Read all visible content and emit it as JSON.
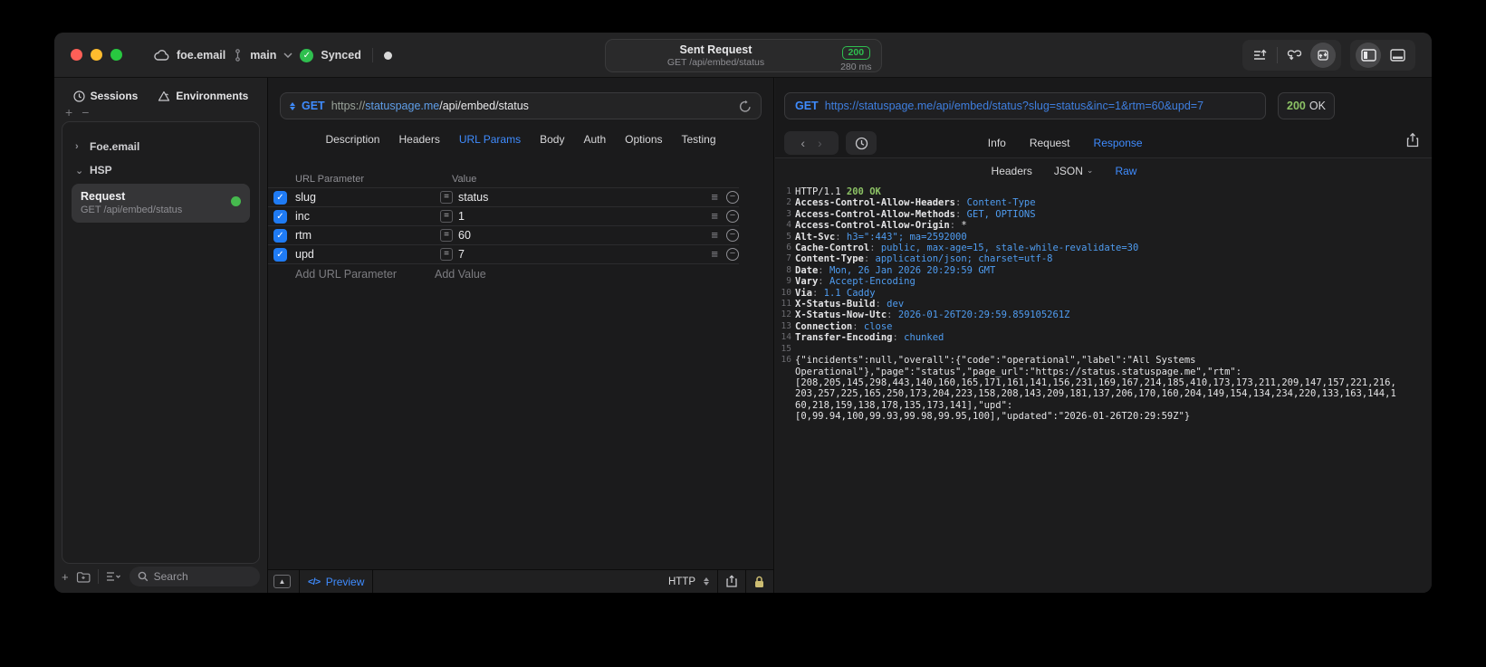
{
  "colors": {
    "accent_blue": "#3f8cff",
    "code_blue": "#4f9cf0",
    "status_green": "#2fbf4f",
    "code_green": "#8cc265",
    "checkbox_blue": "#1f7bf4"
  },
  "titlebar": {
    "project": "foe.email",
    "branch": "main",
    "sync_status": "Synced",
    "center": {
      "title": "Sent Request",
      "subtitle": "GET /api/embed/status",
      "status_code": "200",
      "duration": "280 ms"
    }
  },
  "sidebar": {
    "tabs": [
      {
        "label": "Sessions"
      },
      {
        "label": "Environments"
      }
    ],
    "tree": [
      {
        "label": "Foe.email"
      },
      {
        "label": "HSP"
      }
    ],
    "request_item": {
      "title": "Request",
      "subtitle": "GET /api/embed/status"
    },
    "search_placeholder": "Search"
  },
  "request": {
    "method": "GET",
    "url_scheme": "https://",
    "url_host": "statuspage.me",
    "url_path": "/api/embed/status",
    "tabs": [
      "Description",
      "Headers",
      "URL Params",
      "Body",
      "Auth",
      "Options",
      "Testing"
    ],
    "active_tab": "URL Params",
    "params_table": {
      "columns": [
        "URL Parameter",
        "Value"
      ],
      "rows": [
        {
          "enabled": true,
          "name": "slug",
          "value": "status"
        },
        {
          "enabled": true,
          "name": "inc",
          "value": "1"
        },
        {
          "enabled": true,
          "name": "rtm",
          "value": "60"
        },
        {
          "enabled": true,
          "name": "upd",
          "value": "7"
        }
      ],
      "add_name_placeholder": "Add URL Parameter",
      "add_value_placeholder": "Add Value"
    },
    "footer": {
      "code_glyph": "</>",
      "preview_label": "Preview",
      "protocol": "HTTP"
    }
  },
  "response": {
    "method": "GET",
    "url": "https://statuspage.me/api/embed/status?slug=status&inc=1&rtm=60&upd=7",
    "status_code": "200",
    "status_text": "OK",
    "tabs": [
      "Info",
      "Request",
      "Response"
    ],
    "active_tab": "Response",
    "subtabs": [
      "Headers",
      "JSON",
      "Raw"
    ],
    "active_subtab": "Raw",
    "body_lines": [
      {
        "num": "1",
        "segments": [
          [
            "HTTP/1.1 ",
            "plain"
          ],
          [
            "200 OK",
            "green"
          ]
        ]
      },
      {
        "num": "2",
        "segments": [
          [
            "Access-Control-Allow-Headers",
            "key"
          ],
          [
            ": ",
            "punct"
          ],
          [
            "Content-Type",
            "val"
          ]
        ]
      },
      {
        "num": "3",
        "segments": [
          [
            "Access-Control-Allow-Methods",
            "key"
          ],
          [
            ": ",
            "punct"
          ],
          [
            "GET, OPTIONS",
            "val"
          ]
        ]
      },
      {
        "num": "4",
        "segments": [
          [
            "Access-Control-Allow-Origin",
            "key"
          ],
          [
            ": ",
            "punct"
          ],
          [
            "*",
            "plain"
          ]
        ]
      },
      {
        "num": "5",
        "segments": [
          [
            "Alt-Svc",
            "key"
          ],
          [
            ": ",
            "punct"
          ],
          [
            "h3=\":443\"; ma=2592000",
            "val"
          ]
        ]
      },
      {
        "num": "6",
        "segments": [
          [
            "Cache-Control",
            "key"
          ],
          [
            ": ",
            "punct"
          ],
          [
            "public, max-age=15, stale-while-revalidate=30",
            "val"
          ]
        ]
      },
      {
        "num": "7",
        "segments": [
          [
            "Content-Type",
            "key"
          ],
          [
            ": ",
            "punct"
          ],
          [
            "application/json; charset=utf-8",
            "val"
          ]
        ]
      },
      {
        "num": "8",
        "segments": [
          [
            "Date",
            "key"
          ],
          [
            ": ",
            "punct"
          ],
          [
            "Mon, 26 Jan 2026 20:29:59 GMT",
            "val"
          ]
        ]
      },
      {
        "num": "9",
        "segments": [
          [
            "Vary",
            "key"
          ],
          [
            ": ",
            "punct"
          ],
          [
            "Accept-Encoding",
            "val"
          ]
        ]
      },
      {
        "num": "10",
        "segments": [
          [
            "Via",
            "key"
          ],
          [
            ": ",
            "punct"
          ],
          [
            "1.1 Caddy",
            "val"
          ]
        ]
      },
      {
        "num": "11",
        "segments": [
          [
            "X-Status-Build",
            "key"
          ],
          [
            ": ",
            "punct"
          ],
          [
            "dev",
            "val"
          ]
        ]
      },
      {
        "num": "12",
        "segments": [
          [
            "X-Status-Now-Utc",
            "key"
          ],
          [
            ": ",
            "punct"
          ],
          [
            "2026-01-26T20:29:59.859105261Z",
            "val"
          ]
        ]
      },
      {
        "num": "13",
        "segments": [
          [
            "Connection",
            "key"
          ],
          [
            ": ",
            "punct"
          ],
          [
            "close",
            "val"
          ]
        ]
      },
      {
        "num": "14",
        "segments": [
          [
            "Transfer-Encoding",
            "key"
          ],
          [
            ": ",
            "punct"
          ],
          [
            "chunked",
            "val"
          ]
        ]
      },
      {
        "num": "15",
        "segments": []
      },
      {
        "num": "16",
        "segments": [
          [
            "{\"incidents\":null,\"overall\":{\"code\":\"operational\",\"label\":\"All Systems",
            "plain"
          ]
        ]
      },
      {
        "num": "",
        "segments": [
          [
            "Operational\"},\"page\":\"status\",\"page_url\":\"https://status.statuspage.me\",\"rtm\":",
            "plain"
          ]
        ]
      },
      {
        "num": "",
        "segments": [
          [
            "[208,205,145,298,443,140,160,165,171,161,141,156,231,169,167,214,185,410,173,173,211,209,147,157,221,216,",
            "plain"
          ]
        ]
      },
      {
        "num": "",
        "segments": [
          [
            "203,257,225,165,250,173,204,223,158,208,143,209,181,137,206,170,160,204,149,154,134,234,220,133,163,144,1",
            "plain"
          ]
        ]
      },
      {
        "num": "",
        "segments": [
          [
            "60,218,159,138,178,135,173,141],\"upd\":",
            "plain"
          ]
        ]
      },
      {
        "num": "",
        "segments": [
          [
            "[0,99.94,100,99.93,99.98,99.95,100],\"updated\":\"2026-01-26T20:29:59Z\"}",
            "plain"
          ]
        ]
      }
    ]
  }
}
